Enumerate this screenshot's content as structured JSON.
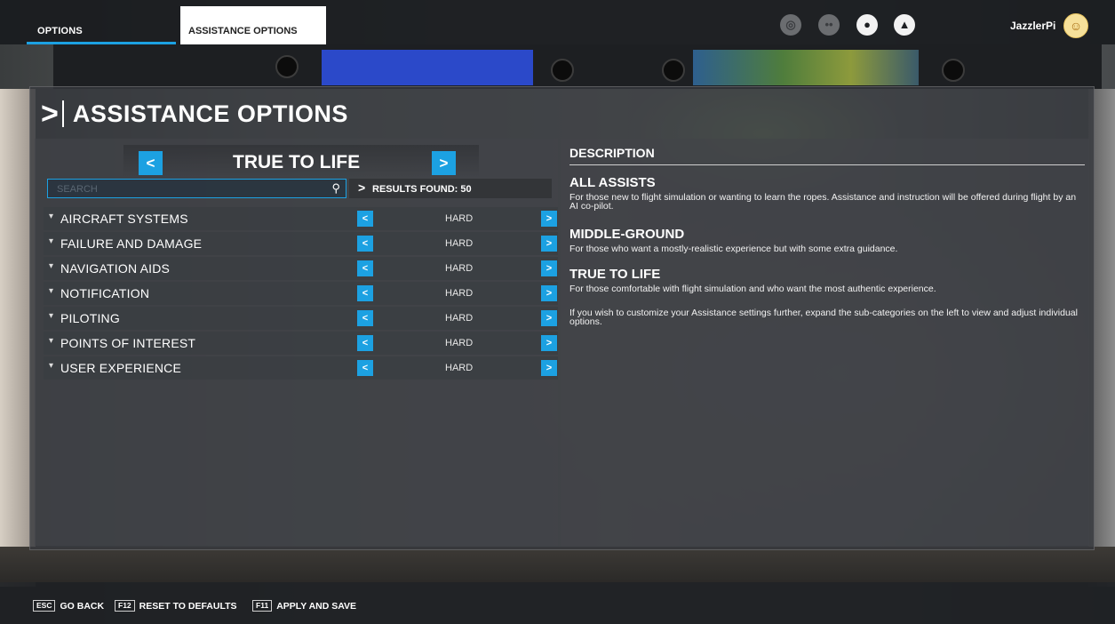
{
  "topbar": {
    "tab_options": "OPTIONS",
    "tab_assistance": "ASSISTANCE OPTIONS",
    "username": "JazzlerPi"
  },
  "page": {
    "title": "ASSISTANCE OPTIONS"
  },
  "preset": {
    "name": "TRUE TO LIFE"
  },
  "search": {
    "placeholder": "SEARCH",
    "results_found": "RESULTS FOUND: 50"
  },
  "categories": [
    {
      "label": "AIRCRAFT SYSTEMS",
      "value": "HARD"
    },
    {
      "label": "FAILURE AND DAMAGE",
      "value": "HARD"
    },
    {
      "label": "NAVIGATION AIDS",
      "value": "HARD"
    },
    {
      "label": "NOTIFICATION",
      "value": "HARD"
    },
    {
      "label": "PILOTING",
      "value": "HARD"
    },
    {
      "label": "POINTS OF INTEREST",
      "value": "HARD"
    },
    {
      "label": "USER EXPERIENCE",
      "value": "HARD"
    }
  ],
  "description": {
    "heading": "DESCRIPTION",
    "modes": [
      {
        "title": "ALL ASSISTS",
        "text": "For those new to flight simulation or wanting to learn the ropes. Assistance and instruction will be offered during flight by an AI co-pilot."
      },
      {
        "title": "MIDDLE-GROUND",
        "text": "For those who want a mostly-realistic experience but with some extra guidance."
      },
      {
        "title": "TRUE TO LIFE",
        "text": "For those comfortable with flight simulation and who want the most authentic experience."
      }
    ],
    "footer": "If you wish to customize your Assistance settings further, expand the sub-categories on the left to view and adjust individual options."
  },
  "bottombar": {
    "go_back": {
      "key": "ESC",
      "label": "GO BACK"
    },
    "reset": {
      "key": "F12",
      "label": "RESET TO DEFAULTS"
    },
    "apply": {
      "key": "F11",
      "label": "APPLY AND SAVE"
    }
  },
  "icons": {
    "prev": "chevron-left-icon",
    "next": "chevron-right-icon",
    "search": "search-icon",
    "activity": "activity-icon",
    "friends": "friends-icon",
    "profile": "profile-icon",
    "notifications": "bell-icon"
  },
  "colors": {
    "accent": "#1ca1e2"
  }
}
